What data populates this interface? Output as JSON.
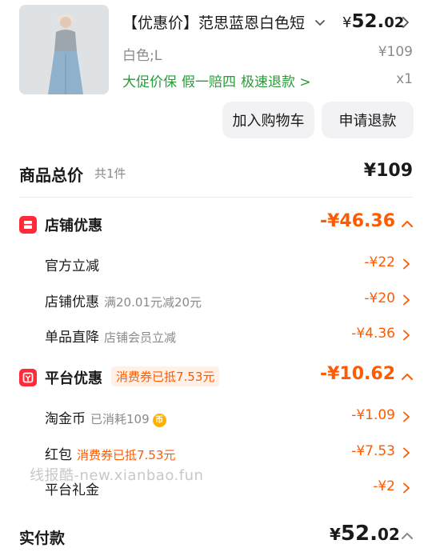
{
  "product": {
    "title": "【优惠价】范思蓝恩白色短",
    "price_currency": "¥",
    "price_int": "52.",
    "price_dec": "02",
    "sku": "白色;L",
    "original_price": "¥109",
    "services": [
      "大促价保",
      "假一赔四",
      "极速退款 >"
    ],
    "quantity": "x1"
  },
  "buttons": {
    "add_to_cart": "加入购物车",
    "request_refund": "申请退款"
  },
  "summary": {
    "label": "商品总价",
    "count": "共1件",
    "total": "¥109"
  },
  "store_discount": {
    "title": "店铺优惠",
    "amount": "-¥46.36",
    "items": [
      {
        "label": "官方立减",
        "sub": "",
        "amount": "-¥22"
      },
      {
        "label": "店铺优惠",
        "sub": "满20.01元减20元",
        "amount": "-¥20"
      },
      {
        "label": "单品直降",
        "sub": "店铺会员立减",
        "amount": "-¥4.36"
      }
    ]
  },
  "platform_discount": {
    "title": "平台优惠",
    "badge": "消费券已抵7.53元",
    "amount": "-¥10.62",
    "items": [
      {
        "label": "淘金币",
        "sub": "已消耗109",
        "amount": "-¥1.09"
      },
      {
        "label": "红包",
        "sub": "消费券已抵7.53元",
        "amount": "-¥7.53"
      },
      {
        "label": "平台礼金",
        "sub": "",
        "amount": "-¥2"
      }
    ]
  },
  "watermark": "线报酷-new.xianbao.fun",
  "payment": {
    "label": "实付款",
    "currency": "¥",
    "int": "52.",
    "dec": "02"
  },
  "colors": {
    "accent_orange": "#ff5a00",
    "service_green": "#2b9a3a",
    "section_icon_red": "#ff2a3a"
  },
  "icons": [
    "chevron-down-icon",
    "chevron-right-icon",
    "store-icon",
    "platform-icon",
    "coin-icon",
    "chevron-up-icon"
  ]
}
